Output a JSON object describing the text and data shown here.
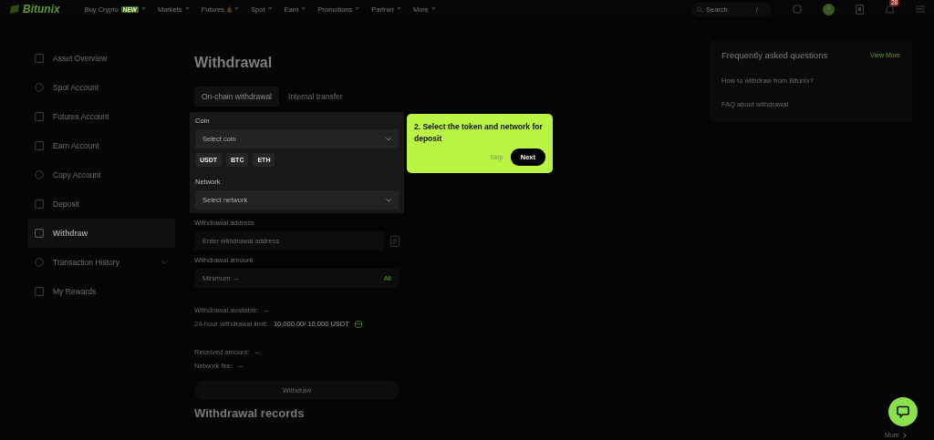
{
  "nav": {
    "logo": "Bitunix",
    "items": [
      {
        "label": "Buy Crypto",
        "badge": "NEW",
        "hot": false
      },
      {
        "label": "Markets",
        "hot": false
      },
      {
        "label": "Futures",
        "hot": true
      },
      {
        "label": "Spot",
        "hot": false
      },
      {
        "label": "Earn",
        "hot": false
      },
      {
        "label": "Promotions",
        "hot": false
      },
      {
        "label": "Partner",
        "hot": false
      },
      {
        "label": "More",
        "hot": false
      }
    ],
    "search": {
      "placeholder": "Search",
      "shortcut": "/"
    },
    "notifications": "28"
  },
  "sidebar": {
    "items": [
      {
        "label": "Asset Overview",
        "selected": false,
        "kind": "link"
      },
      {
        "label": "Spot Account",
        "selected": false,
        "kind": "link"
      },
      {
        "label": "Futures Account",
        "selected": false,
        "kind": "link"
      },
      {
        "label": "Earn Account",
        "selected": false,
        "kind": "link"
      },
      {
        "label": "Copy Account",
        "selected": false,
        "kind": "link"
      },
      {
        "label": "Deposit",
        "selected": false,
        "kind": "link"
      },
      {
        "label": "Withdraw",
        "selected": true,
        "kind": "link"
      },
      {
        "label": "Transaction History",
        "selected": false,
        "kind": "group"
      },
      {
        "label": "My Rewards",
        "selected": false,
        "kind": "link"
      }
    ]
  },
  "title": "Withdrawal",
  "tabs": [
    {
      "label": "On-chain withdrawal",
      "selected": true
    },
    {
      "label": "Internal transfer",
      "selected": false
    }
  ],
  "coin": {
    "label": "Coin",
    "placeholder": "Select coin",
    "chips": [
      "USDT",
      "BTC",
      "ETH"
    ]
  },
  "network": {
    "label": "Network",
    "placeholder": "Select network"
  },
  "address": {
    "label": "Withdrawal address",
    "placeholder": "Enter withdrawal address"
  },
  "amount": {
    "label": "Withdrawal amount",
    "placeholder": "Minimum:  --",
    "all": "All"
  },
  "limits": [
    {
      "label": "Withdrawal available:",
      "value": "--",
      "accent": false,
      "icon": false
    },
    {
      "label": "24-hour withdrawal limit:",
      "value": "10,000.00/ 10,000 USDT",
      "accent": false,
      "icon": true
    }
  ],
  "fees": [
    {
      "label": "Received amount:",
      "value": "--",
      "accent": true
    },
    {
      "label": "Network fee:",
      "value": "--",
      "accent": false
    }
  ],
  "withdraw_button": "Withdraw",
  "records": {
    "title": "Withdrawal records",
    "more": "More"
  },
  "faq": {
    "title": "Frequently asked questions",
    "view_more": "View More",
    "items": [
      "How to withdraw from Bitunix?",
      "FAQ about withdrawal"
    ]
  },
  "tooltip": {
    "text": "2. Select the token and network for deposit",
    "skip": "Skip",
    "next": "Next"
  }
}
